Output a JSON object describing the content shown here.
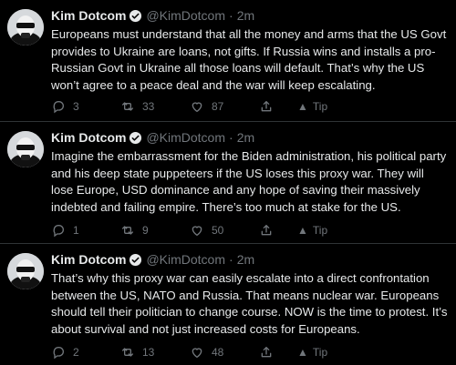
{
  "author": {
    "name": "Kim Dotcom",
    "handle": "@KimDotcom",
    "separator": "·"
  },
  "tweets": [
    {
      "time": "2m",
      "text": "Europeans must understand that all the money and arms that the US Govt provides to Ukraine are loans, not gifts. If Russia wins and installs a pro-Russian Govt in Ukraine all those loans will default. That’s why the US won’t agree to a peace deal and the war will keep escalating.",
      "replies": "3",
      "retweets": "33",
      "likes": "87",
      "tip_label": "Tip"
    },
    {
      "time": "2m",
      "text": "Imagine the embarrassment for the Biden administration, his political party and his deep state puppeteers if the US loses this proxy war. They will lose Europe, USD dominance and any hope of saving their massively indebted and failing empire. There’s too much at stake for the US.",
      "replies": "1",
      "retweets": "9",
      "likes": "50",
      "tip_label": "Tip"
    },
    {
      "time": "2m",
      "text": "That’s why this proxy war can easily escalate into a direct confrontation between the US, NATO and Russia. That means nuclear war. Europeans should tell their politician to change course. NOW is the time to protest. It’s about survival and not just increased costs for Europeans.",
      "replies": "2",
      "retweets": "13",
      "likes": "48",
      "tip_label": "Tip"
    }
  ],
  "colors": {
    "background": "#000000",
    "text": "#e7e9ea",
    "muted": "#71767b",
    "verified": "#1d9bf0"
  }
}
